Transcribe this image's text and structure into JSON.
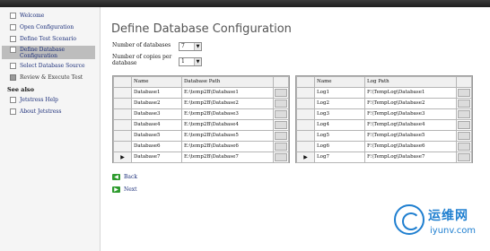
{
  "sidebar": {
    "items": [
      {
        "label": "Welcome",
        "checked": false
      },
      {
        "label": "Open Configuration",
        "checked": false
      },
      {
        "label": "Define Test Scenario",
        "checked": false
      },
      {
        "label": "Define Database Configuration",
        "checked": false,
        "active": true
      },
      {
        "label": "Select Database Source",
        "checked": false
      },
      {
        "label": "Review & Execute Test",
        "checked": true
      }
    ],
    "see_also_heading": "See also",
    "see_also": [
      {
        "label": "Jetstress Help"
      },
      {
        "label": "About Jetstress"
      }
    ]
  },
  "main": {
    "title": "Define Database Configuration",
    "num_databases_label": "Number of databases",
    "num_databases_value": "7",
    "num_copies_label": "Number of copies per database",
    "num_copies_value": "1",
    "db_table": {
      "columns": [
        "Name",
        "Database Path"
      ],
      "rows": [
        {
          "name": "Database1",
          "path": "E:\\temp2B\\Database1"
        },
        {
          "name": "Database2",
          "path": "E:\\temp2B\\Database2"
        },
        {
          "name": "Database3",
          "path": "E:\\temp2B\\Database3"
        },
        {
          "name": "Database4",
          "path": "E:\\temp2B\\Database4"
        },
        {
          "name": "Database5",
          "path": "E:\\temp2B\\Database5"
        },
        {
          "name": "Database6",
          "path": "E:\\temp2B\\Database6"
        },
        {
          "name": "Database7",
          "path": "E:\\temp2B\\Database7"
        }
      ],
      "current_row_marker": "▶"
    },
    "log_table": {
      "columns": [
        "Name",
        "Log Path"
      ],
      "rows": [
        {
          "name": "Log1",
          "path": "F:\\TempLog\\Database1"
        },
        {
          "name": "Log2",
          "path": "F:\\TempLog\\Database2"
        },
        {
          "name": "Log3",
          "path": "F:\\TempLog\\Database3"
        },
        {
          "name": "Log4",
          "path": "F:\\TempLog\\Database4"
        },
        {
          "name": "Log5",
          "path": "F:\\TempLog\\Database5"
        },
        {
          "name": "Log6",
          "path": "F:\\TempLog\\Database6"
        },
        {
          "name": "Log7",
          "path": "F:\\TempLog\\Database7"
        }
      ],
      "current_row_marker": "▶"
    },
    "back_label": "Back",
    "next_label": "Next"
  },
  "watermark": {
    "cn_text": "运维网",
    "en_text": "iyunv.com"
  },
  "colors": {
    "link": "#1c2f7a",
    "nav_active": "#bdbdbd",
    "action_icon": "#2e9b2e",
    "watermark": "#1f7fd0"
  }
}
